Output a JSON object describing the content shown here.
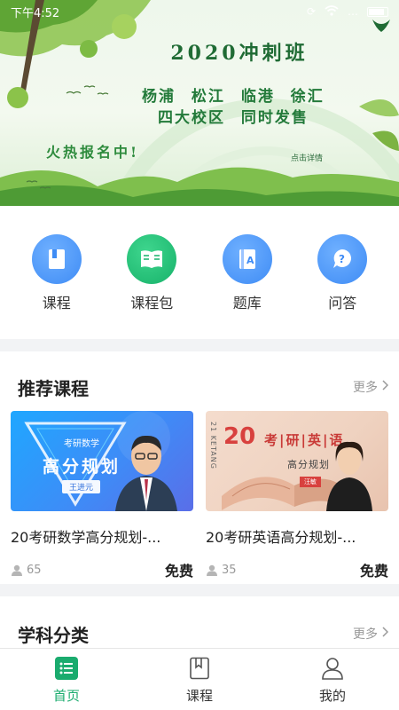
{
  "status_bar": {
    "time": "下午4:52",
    "extra": "…"
  },
  "banner": {
    "title": "2020冲刺班",
    "line1": "杨浦 松江 临港 徐汇",
    "line2": "四大校区 同时发售",
    "hot": "火热报名中!",
    "detail": "点击详情"
  },
  "quick_nav": [
    {
      "label": "课程",
      "icon": "bookmark-book-icon",
      "color": "#3f8cf5"
    },
    {
      "label": "课程包",
      "icon": "open-book-icon",
      "color": "#17b26a"
    },
    {
      "label": "题库",
      "icon": "question-bank-icon",
      "color": "#3f8cf5"
    },
    {
      "label": "问答",
      "icon": "question-bubble-icon",
      "color": "#3f8cf5"
    }
  ],
  "recommend": {
    "title": "推荐课程",
    "more": "更多",
    "courses": [
      {
        "title": "20考研数学高分规划-...",
        "count": "65",
        "price": "免费",
        "thumb": {
          "tag": "考研数学",
          "big": "高分规划",
          "name": "王进元"
        }
      },
      {
        "title": "20考研英语高分规划-...",
        "count": "35",
        "price": "免费",
        "thumb": {
          "big": "20",
          "text": "考|研|英|语",
          "sub": "高分规划",
          "name": "汪敏",
          "side": "21 KETANG"
        }
      }
    ]
  },
  "subjects": {
    "title": "学科分类",
    "more": "更多"
  },
  "tabs": [
    {
      "label": "首页",
      "active": true
    },
    {
      "label": "课程",
      "active": false
    },
    {
      "label": "我的",
      "active": false
    }
  ],
  "colors": {
    "accent": "#1aab6e",
    "blue": "#3f8cf5"
  }
}
